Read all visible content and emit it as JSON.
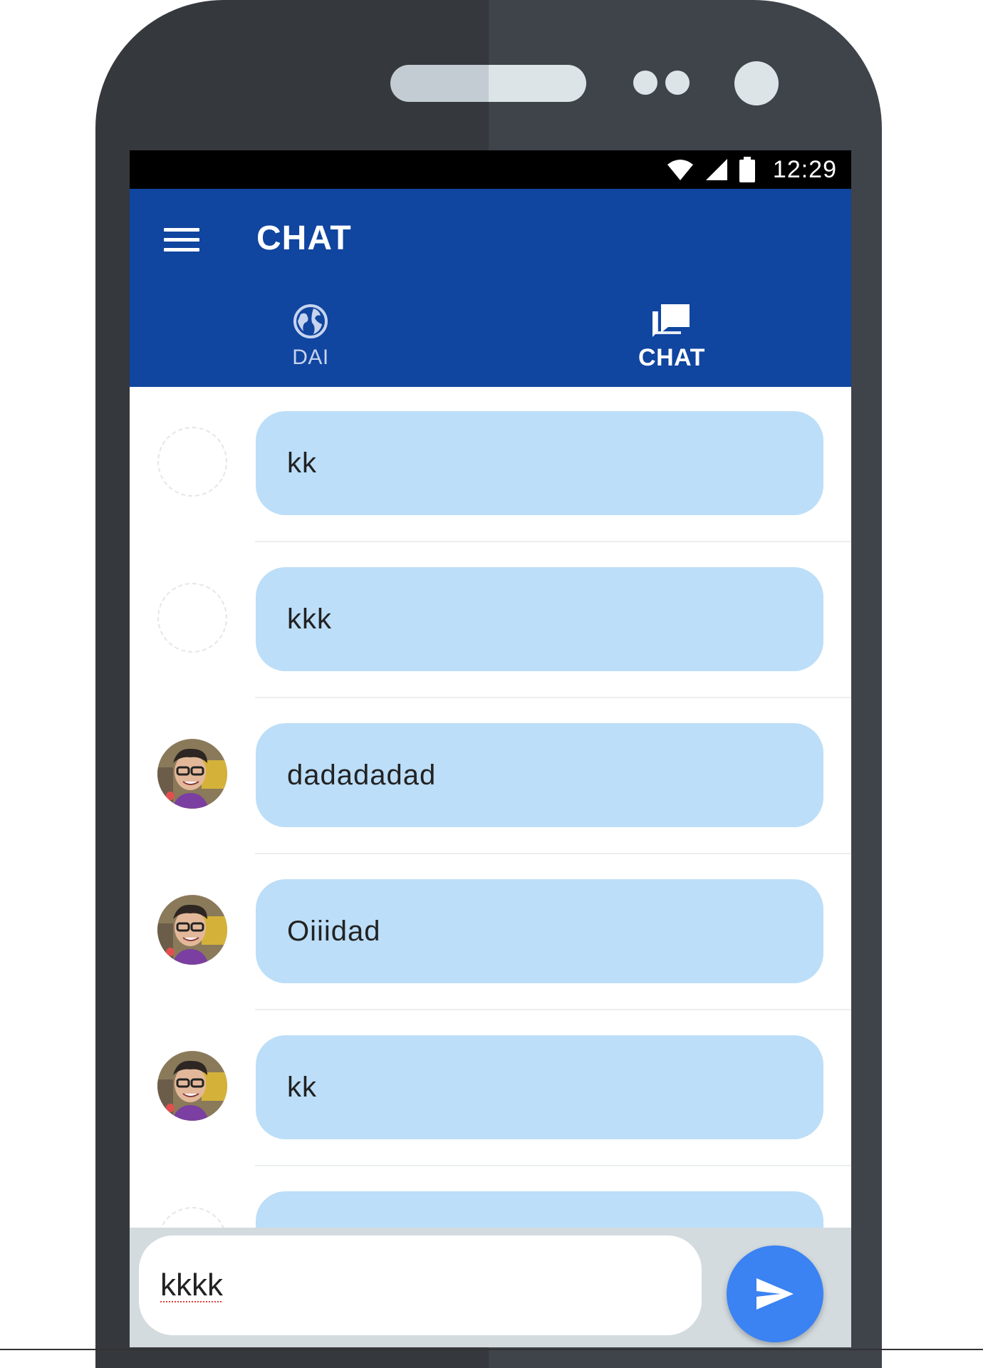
{
  "status_bar": {
    "time": "12:29",
    "icons": [
      "wifi-icon",
      "signal-icon",
      "battery-icon"
    ]
  },
  "app_bar": {
    "title": "CHAT",
    "menu_icon": "hamburger-menu-icon"
  },
  "tabs": [
    {
      "label": "DAI",
      "icon": "globe-icon",
      "selected": false
    },
    {
      "label": "CHAT",
      "icon": "chat-bubbles-icon",
      "selected": true
    }
  ],
  "messages": [
    {
      "text": "kk",
      "avatar": "blank"
    },
    {
      "text": "kkk",
      "avatar": "blank"
    },
    {
      "text": "dadadadad",
      "avatar": "photo"
    },
    {
      "text": "Oiiidad",
      "avatar": "photo"
    },
    {
      "text": "kk",
      "avatar": "photo"
    },
    {
      "text": "",
      "avatar": "blank"
    }
  ],
  "composer": {
    "value": "kkkk",
    "send_icon": "send-icon"
  },
  "colors": {
    "app_bar": "#1045a0",
    "bubble": "#bcdef8",
    "send_button": "#3b82f2",
    "composer_bg": "#d3dbdf"
  }
}
